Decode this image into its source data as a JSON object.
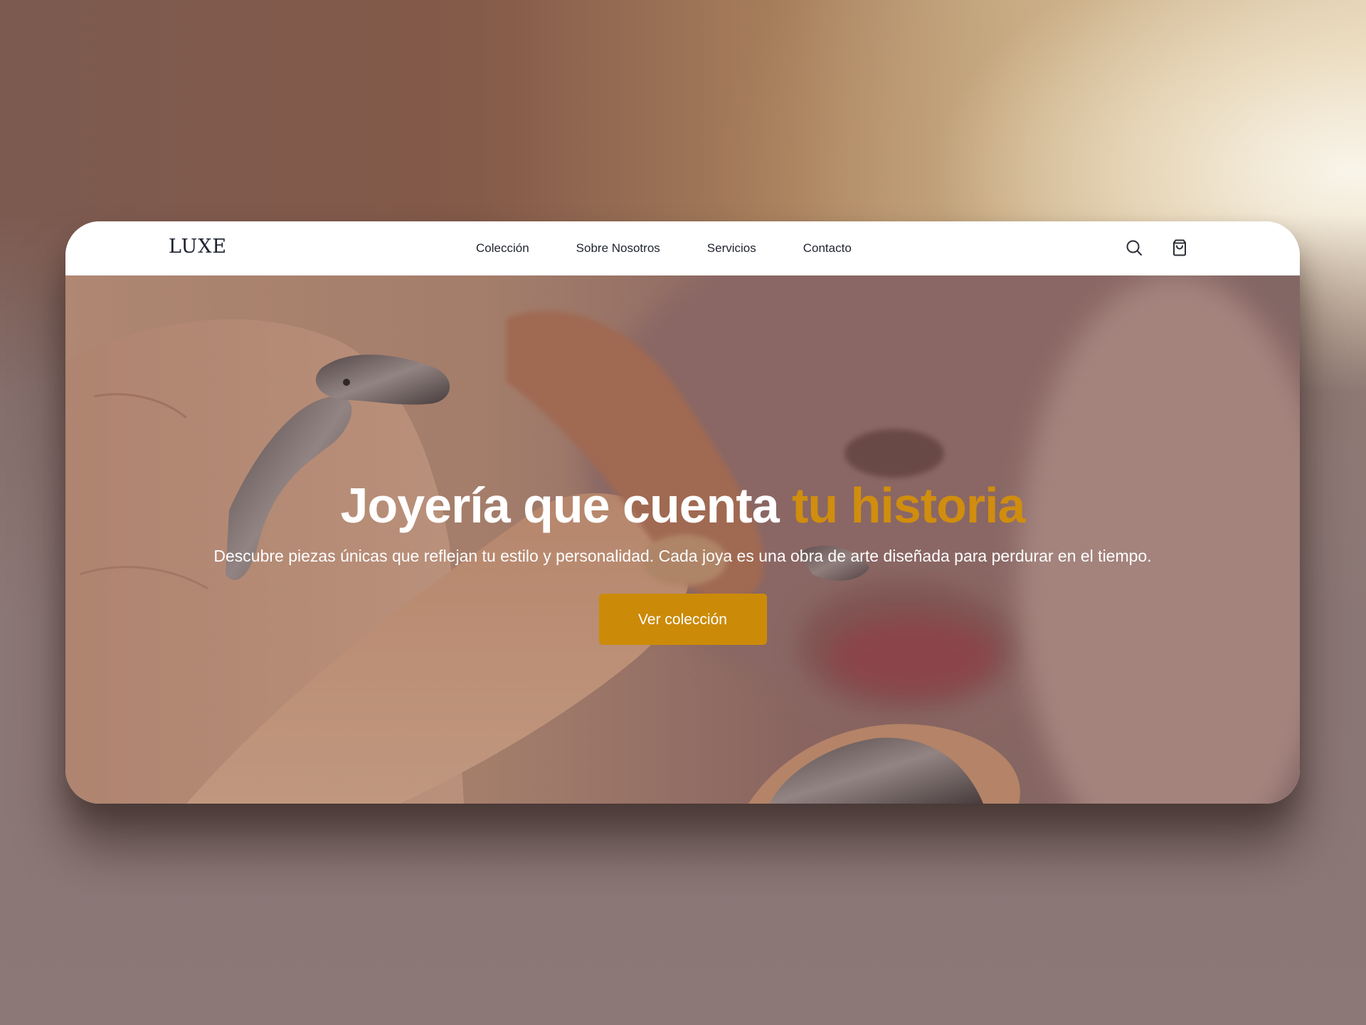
{
  "brand": {
    "logo_text": "LUXE"
  },
  "nav": {
    "links": [
      {
        "label": "Colección"
      },
      {
        "label": "Sobre Nosotros"
      },
      {
        "label": "Servicios"
      },
      {
        "label": "Contacto"
      }
    ],
    "icons": [
      "search-icon",
      "shopping-bag-icon"
    ]
  },
  "hero": {
    "title_main": "Joyería que cuenta",
    "title_accent": "tu historia",
    "subtitle": "Descubre piezas únicas que reflejan tu estilo y personalidad. Cada joya es una obra de arte diseñada para perdurar en el tiempo.",
    "cta_label": "Ver colección",
    "image_subject": "hands-with-silver-animal-rings"
  },
  "colors": {
    "accent": "#cb8b08",
    "accent_text": "#d08d0e",
    "nav_text": "#1f2330",
    "hero_text": "#ffffff"
  }
}
